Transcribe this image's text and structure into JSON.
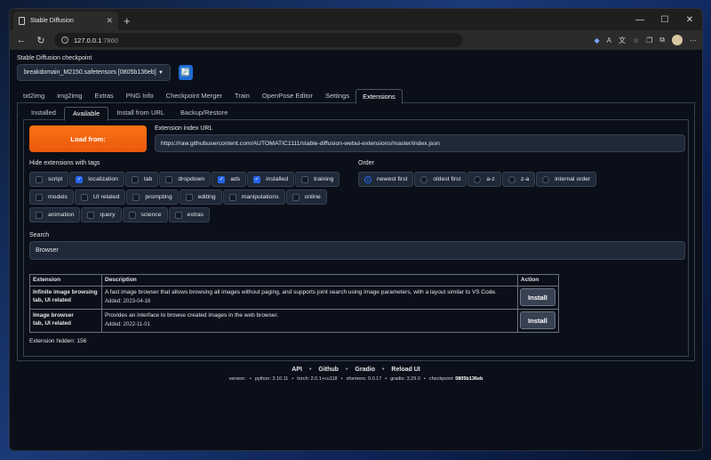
{
  "browser": {
    "tab_title": "Stable Diffusion",
    "url_host": "127.0.0.1",
    "url_port": ":7860"
  },
  "checkpoint": {
    "label": "Stable Diffusion checkpoint",
    "value": "breakdomain_M2150.safetensors [0805b136eb]"
  },
  "main_tabs": [
    "txt2img",
    "img2img",
    "Extras",
    "PNG Info",
    "Checkpoint Merger",
    "Train",
    "OpenPose Editor",
    "Settings",
    "Extensions"
  ],
  "sub_tabs": [
    "Installed",
    "Available",
    "Install from URL",
    "Backup/Restore"
  ],
  "available": {
    "load_button": "Load from:",
    "index_label": "Extension index URL",
    "index_url": "https://raw.githubusercontent.com/AUTOMATIC1111/stable-diffusion-webui-extensions/master/index.json",
    "hide_label": "Hide extensions with tags",
    "tags": [
      {
        "label": "script",
        "checked": false
      },
      {
        "label": "localization",
        "checked": true
      },
      {
        "label": "tab",
        "checked": false
      },
      {
        "label": "dropdown",
        "checked": false
      },
      {
        "label": "ads",
        "checked": true
      },
      {
        "label": "installed",
        "checked": true
      },
      {
        "label": "training",
        "checked": false
      },
      {
        "label": "models",
        "checked": false
      },
      {
        "label": "UI related",
        "checked": false
      },
      {
        "label": "prompting",
        "checked": false
      },
      {
        "label": "editing",
        "checked": false
      },
      {
        "label": "manipulations",
        "checked": false
      },
      {
        "label": "online",
        "checked": false
      },
      {
        "label": "animation",
        "checked": false
      },
      {
        "label": "query",
        "checked": false
      },
      {
        "label": "science",
        "checked": false
      },
      {
        "label": "extras",
        "checked": false
      }
    ],
    "order_label": "Order",
    "orders": [
      {
        "label": "newest first",
        "selected": true
      },
      {
        "label": "oldest first",
        "selected": false
      },
      {
        "label": "a-z",
        "selected": false
      },
      {
        "label": "z-a",
        "selected": false
      },
      {
        "label": "internal order",
        "selected": false
      }
    ],
    "search_label": "Search",
    "search_value": "Browser",
    "table_headers": [
      "Extension",
      "Description",
      "Action"
    ],
    "rows": [
      {
        "name": "Infinite image browsing",
        "tags": "tab, UI related",
        "description": "A fast image browser that allows browsing all images without paging, and supports joint search using image parameters, with a layout similar to VS Code.",
        "added": "Added: 2023-04-16",
        "action": "Install"
      },
      {
        "name": "Image browser",
        "tags": "tab, UI related",
        "description": "Provides an interface to browse created images in the web browser.",
        "added": "Added: 2022-11-01",
        "action": "Install"
      }
    ],
    "hidden_count": "Extension hidden: 156"
  },
  "footer": {
    "links": [
      "API",
      "Github",
      "Gradio",
      "Reload UI"
    ],
    "separator": "•",
    "versions": [
      {
        "label": "version:",
        "value": ""
      },
      {
        "label": "python:",
        "value": "3.10.11"
      },
      {
        "label": "torch:",
        "value": "2.0.1+cu118"
      },
      {
        "label": "xformers:",
        "value": "0.0.17"
      },
      {
        "label": "gradio:",
        "value": "3.29.0"
      },
      {
        "label": "checkpoint:",
        "value": "0805b136eb"
      }
    ]
  }
}
